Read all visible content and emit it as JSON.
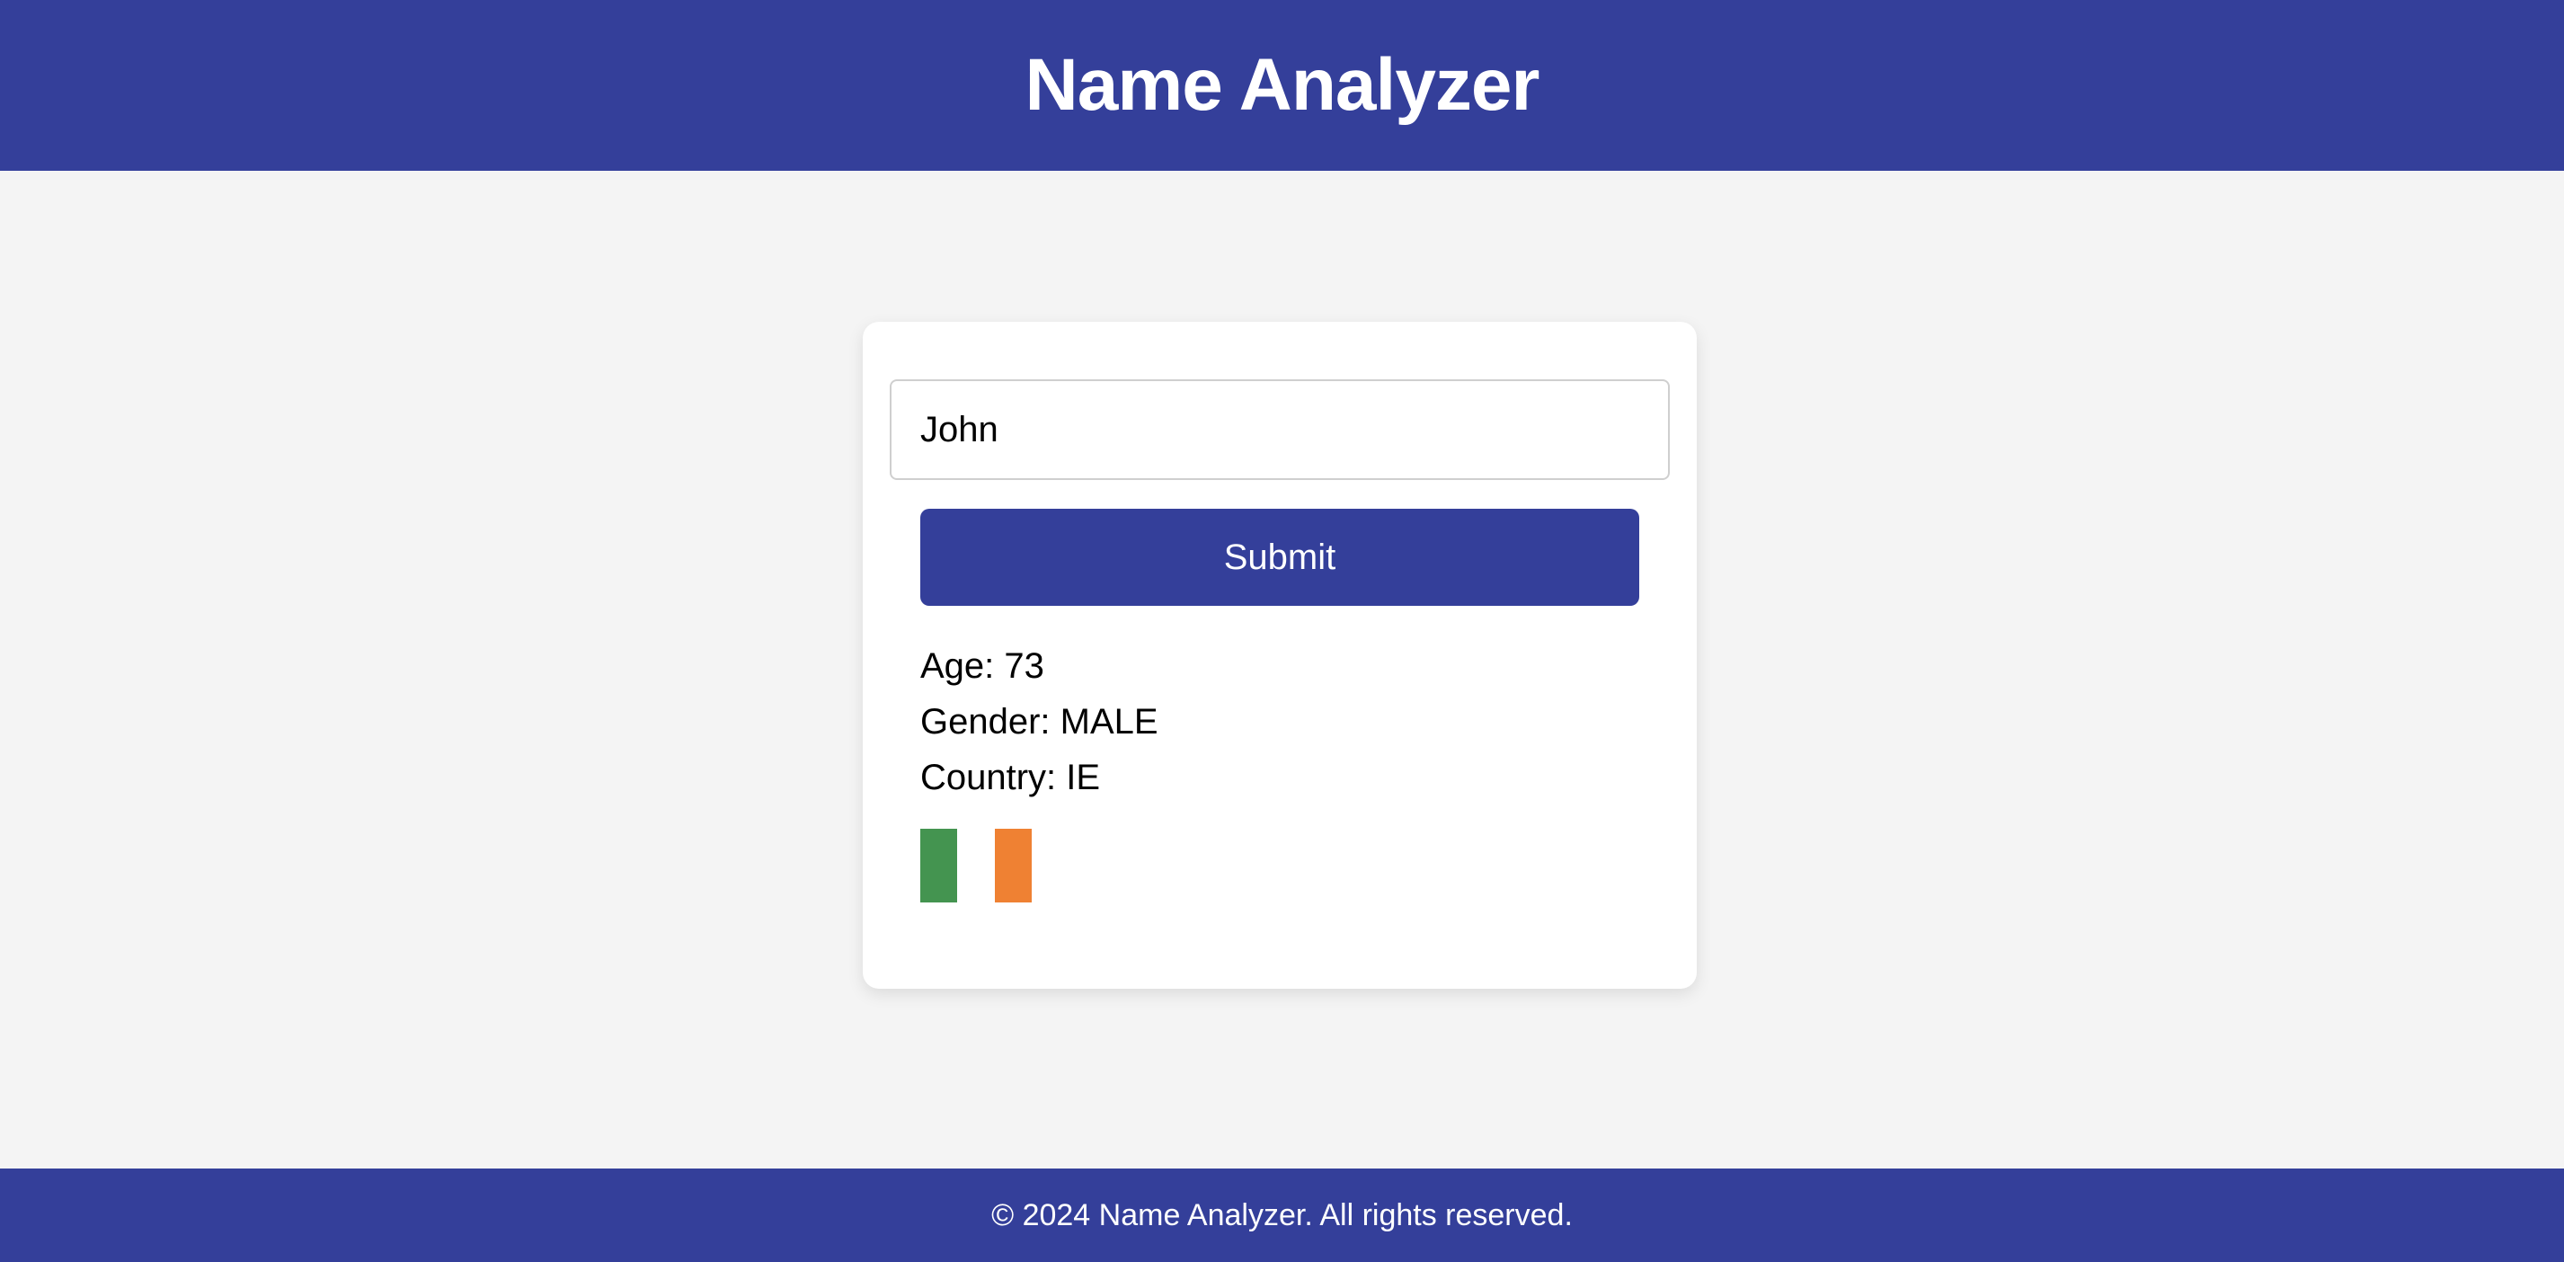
{
  "header": {
    "title": "Name Analyzer"
  },
  "form": {
    "name_value": "John",
    "submit_label": "Submit"
  },
  "results": {
    "age": "Age: 73",
    "gender": "Gender: MALE",
    "country": "Country: IE"
  },
  "flag": {
    "icon": "flag-ireland-icon",
    "colors": [
      "#449450",
      "#ffffff",
      "#ef8133"
    ]
  },
  "footer": {
    "text": "© 2024 Name Analyzer. All rights reserved."
  },
  "colors": {
    "primary": "#343f9a",
    "background": "#f4f4f4",
    "card": "#ffffff"
  }
}
